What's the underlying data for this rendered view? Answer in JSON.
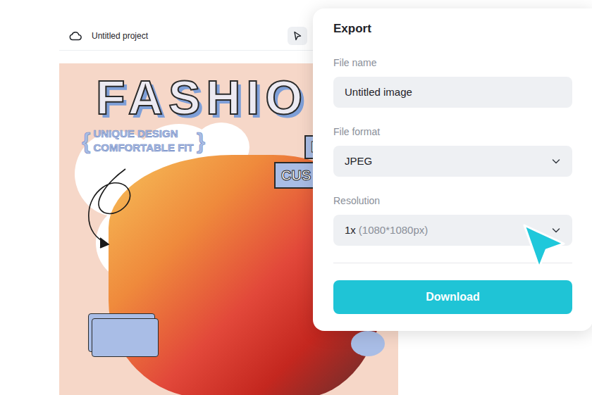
{
  "project": {
    "title": "Untitled project"
  },
  "design": {
    "headline": "FASHIO",
    "brace_left": "{",
    "taglines": [
      "UNIQUE DESIGN",
      "COMFORTABLE FIT"
    ],
    "brace_right": "}",
    "badge": "D",
    "label": "CUS"
  },
  "export": {
    "title": "Export",
    "fields": [
      {
        "label": "File name",
        "kind": "input",
        "value": "Untitled image"
      },
      {
        "label": "File format",
        "kind": "select",
        "value": "JPEG"
      },
      {
        "label": "Resolution",
        "kind": "select",
        "value": "1x",
        "hint": "(1080*1080px)"
      }
    ],
    "button": "Download"
  }
}
